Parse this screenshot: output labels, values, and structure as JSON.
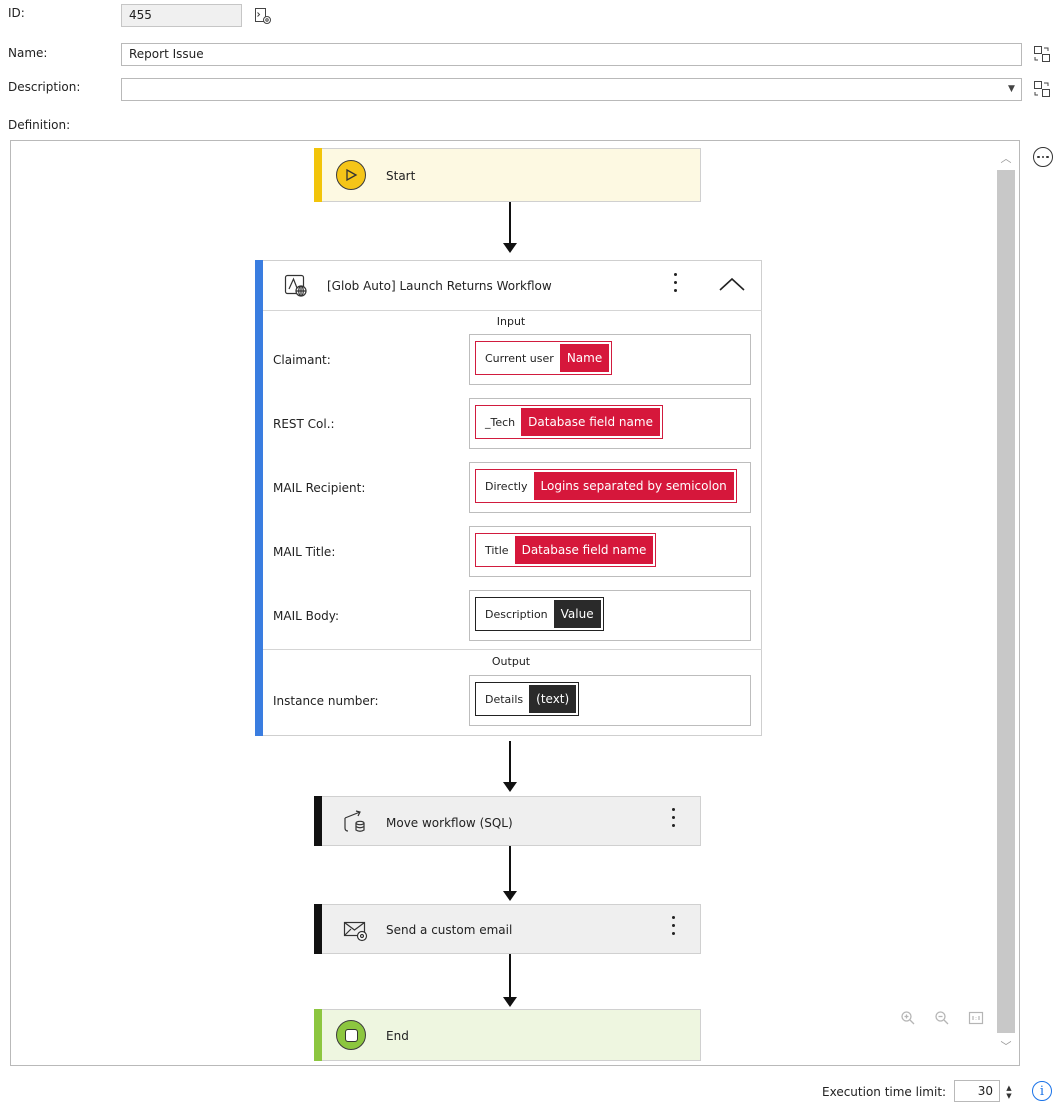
{
  "form": {
    "id_label": "ID:",
    "id_value": "455",
    "name_label": "Name:",
    "name_value": "Report Issue",
    "description_label": "Description:",
    "description_value": "",
    "definition_label": "Definition:"
  },
  "workflow": {
    "start_label": "Start",
    "action": {
      "title": "[Glob Auto] Launch Returns Workflow",
      "input_header": "Input",
      "output_header": "Output",
      "inputs": [
        {
          "label": "Claimant:",
          "left": "Current user",
          "right": "Name",
          "style": "red"
        },
        {
          "label": "REST Col.:",
          "left": "_Tech",
          "right": "Database field name",
          "style": "red"
        },
        {
          "label": "MAIL Recipient:",
          "left": "Directly",
          "right": "Logins separated by semicolon",
          "style": "red"
        },
        {
          "label": "MAIL Title:",
          "left": "Title",
          "right": "Database field name",
          "style": "red"
        },
        {
          "label": "MAIL Body:",
          "left": "Description",
          "right": "Value",
          "style": "dark"
        }
      ],
      "outputs": [
        {
          "label": "Instance number:",
          "left": "Details",
          "right": "(text)",
          "style": "dark"
        }
      ]
    },
    "move_label": "Move workflow (SQL)",
    "email_label": "Send a custom email",
    "end_label": "End"
  },
  "footer": {
    "exec_label": "Execution time limit:",
    "exec_value": "30"
  },
  "colors": {
    "start_bar": "#f2c40a",
    "start_bg": "#fdf9e2",
    "action_bar": "#3a7de0",
    "end_bar": "#8cc63f",
    "end_bg": "#eef6e0",
    "chip_red": "#d6173b",
    "chip_dark": "#2a2a2a",
    "info_blue": "#1a73e8"
  }
}
